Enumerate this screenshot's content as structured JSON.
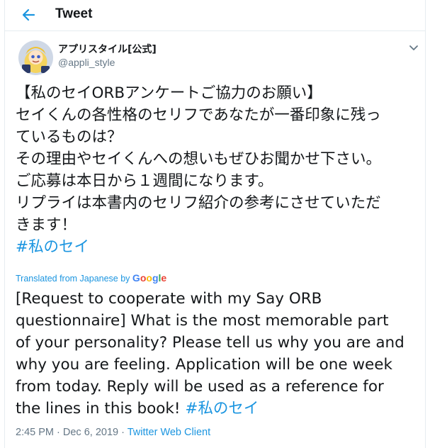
{
  "header": {
    "title": "Tweet",
    "back_icon": "arrow-left-icon"
  },
  "user": {
    "display_name": "アプリスタイル[公式]",
    "handle": "@appli_style",
    "menu_icon": "chevron-down-icon"
  },
  "tweet": {
    "lines": [
      "【私のセイORBアンケートご協力のお願い】",
      "セイくんの各性格のセリフであなたが一番印象に残っ",
      "ているものは？",
      "その理由やセイくんへの想いもぜひお聞かせ下さい。",
      "ご応募は本日から１週間になります。",
      "リプライは本書内のセリフ紹介の参考にさせていただ",
      "きます！"
    ],
    "hashtag": "#私のセイ"
  },
  "translation": {
    "label": "Translated from Japanese by",
    "provider": "Google",
    "lines": [
      "[Request to cooperate with my Say ORB",
      "questionnaire] What is the most memorable part",
      "of your personality? Please tell us why you are and",
      "why you are feeling. Application will be one week",
      "from today. Reply will be used as a reference for",
      "the lines in this book!"
    ],
    "hashtag": "#私のセイ"
  },
  "meta": {
    "time": "2:45 PM",
    "separator1": " · ",
    "date": "Dec 6, 2019",
    "separator2": " · ",
    "client": "Twitter Web Client"
  },
  "colors": {
    "accent": "#1b95e0",
    "text": "#14171a",
    "secondary": "#657786",
    "border": "#e6ecf0"
  }
}
